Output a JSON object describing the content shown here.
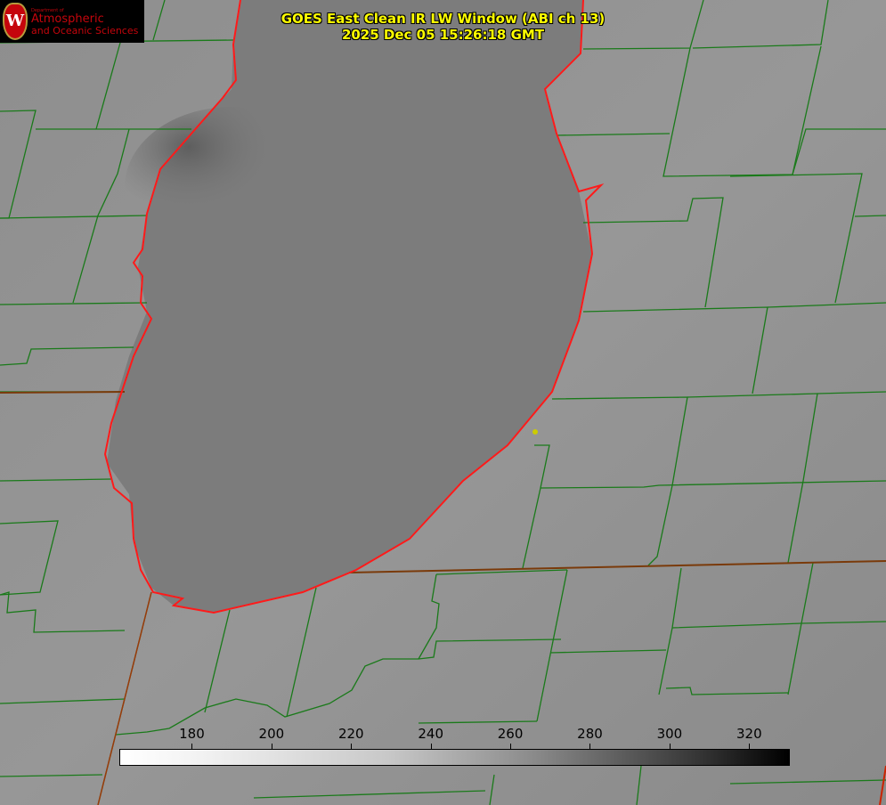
{
  "title": {
    "line1": "GOES East Clean IR LW Window (ABI ch 13)",
    "line2": "2025 Dec 05 15:26:18 GMT"
  },
  "logo": {
    "dept": "Department of",
    "line1": "Atmospheric",
    "line2": "and Oceanic Sciences",
    "crest": "W"
  },
  "colorbar": {
    "min": 162,
    "max": 330,
    "ticks": [
      "180",
      "200",
      "220",
      "240",
      "260",
      "280",
      "300",
      "320"
    ],
    "tick_values": [
      180,
      200,
      220,
      240,
      260,
      280,
      300,
      320
    ]
  },
  "colors": {
    "county": "#1a7a1a",
    "coast": "#ff1a1a",
    "title": "#ffff00",
    "marker": "#cccc00"
  }
}
